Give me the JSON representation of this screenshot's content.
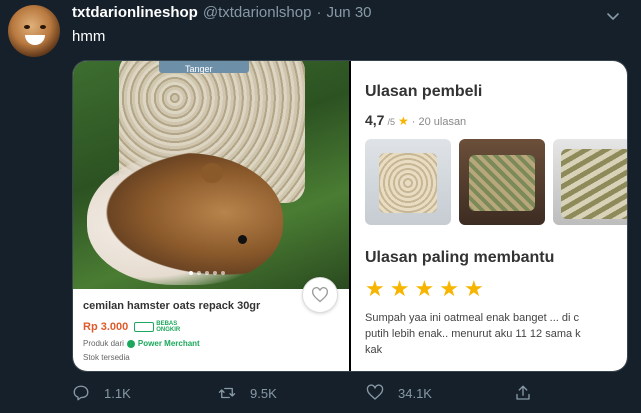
{
  "tweet": {
    "display_name": "txtdarionlineshop",
    "handle": "@txtdarionlshop",
    "separator": "·",
    "date": "Jun 30",
    "text": "hmm"
  },
  "product_card": {
    "bag_brand": "Tanger",
    "title": "cemilan hamster oats repack 30gr",
    "price": "Rp 3.000",
    "free_shipping": [
      "BEBAS",
      "ONGKIR"
    ],
    "seller_prefix": "Produk dari",
    "merchant_type": "Power Merchant",
    "stock": "Stok tersedia"
  },
  "reviews": {
    "title": "Ulasan pembeli",
    "rating": "4,7",
    "rating_scale": "/5",
    "review_count": "· 20 ulasan",
    "helpful_title": "Ulasan paling membantu",
    "stars": 5,
    "review_text_line1": "Sumpah yaa ini oatmeal enak banget ... di c",
    "review_text_line2": "putih lebih enak.. menurut aku 11 12 sama k",
    "review_text_line3": "kak"
  },
  "actions": {
    "reply_count": "1.1K",
    "retweet_count": "9.5K",
    "like_count": "34.1K"
  },
  "colors": {
    "background": "#15202b",
    "muted_text": "#8899a6",
    "price": "#e0592a",
    "merchant_green": "#1ba85c",
    "star": "#f7b500"
  },
  "icons": [
    "chevron-down-icon",
    "heart-outline-icon",
    "reply-icon",
    "retweet-icon",
    "like-icon",
    "share-icon",
    "star-icon",
    "truck-icon"
  ]
}
